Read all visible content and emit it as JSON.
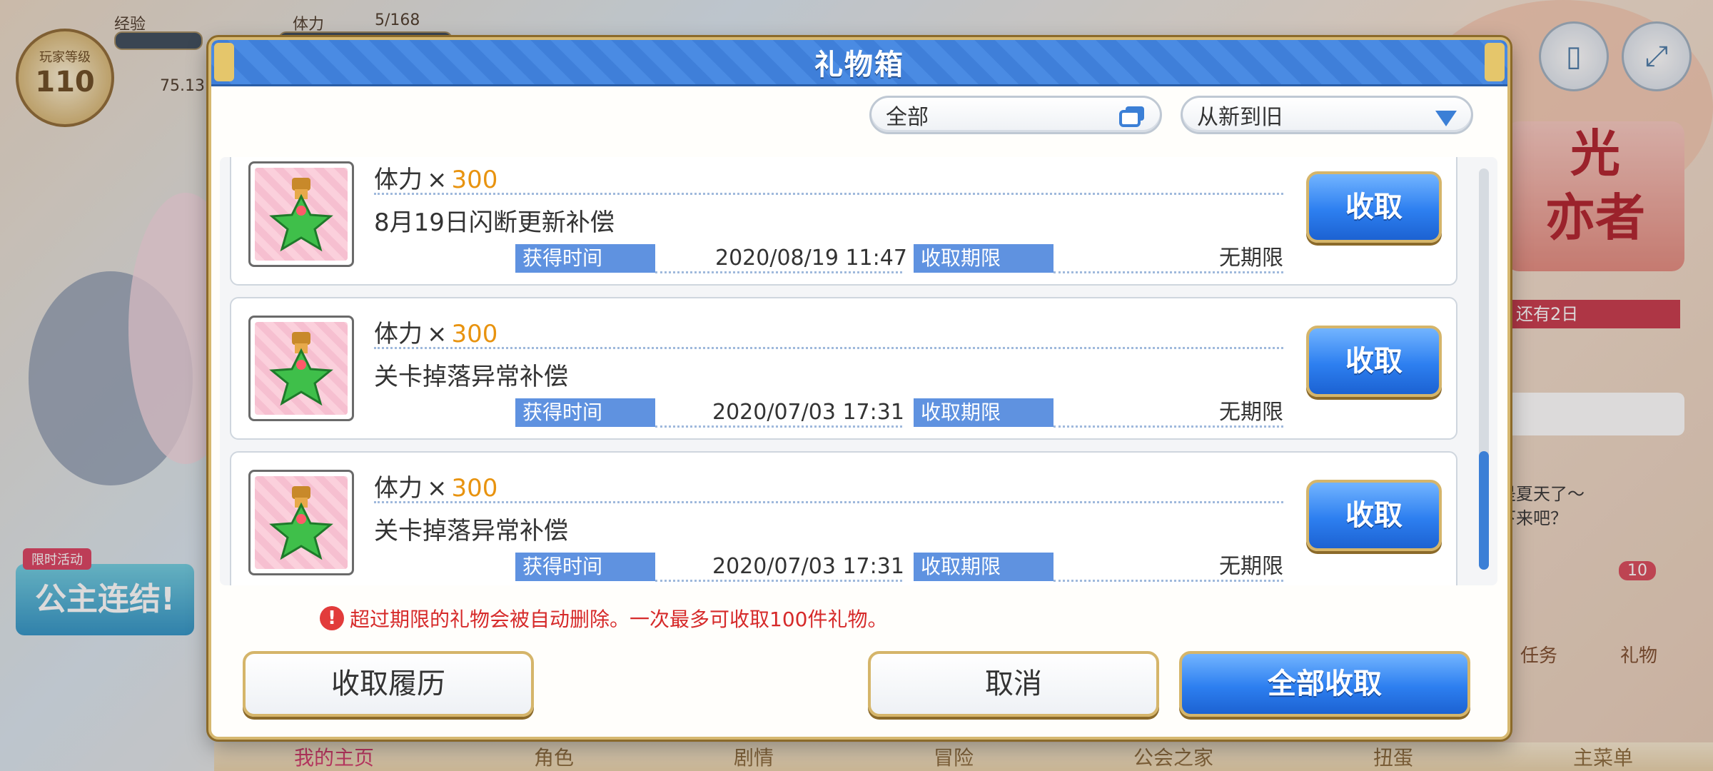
{
  "background": {
    "level_label": "玩家等级",
    "level_value": "110",
    "stamina_label": "体力",
    "stamina_value": "5/168",
    "exp_label": "经验",
    "extra_value": "75.13",
    "event_title": "光\n亦者",
    "event_days": "还有2日",
    "chat_line1": "是夏天了～",
    "chat_line2": "下来吧？",
    "left_tag": "限时活动",
    "left_banner": "公主连结!",
    "quest_label": "任务",
    "gift_label": "礼物",
    "gift_count": "10",
    "nav": [
      "我的主页",
      "角色",
      "剧情",
      "冒险",
      "公会之家",
      "扭蛋",
      "主菜单"
    ]
  },
  "modal": {
    "title": "礼物箱",
    "filter_label": "全部",
    "sort_label": "从新到旧",
    "items": [
      {
        "name": "体力",
        "times": "×",
        "qty": "300",
        "desc": "8月19日闪断更新补偿",
        "obtained_label": "获得时间",
        "obtained_value": "2020/08/19  11:47",
        "expire_label": "收取期限",
        "expire_value": "无期限",
        "claim_label": "收取"
      },
      {
        "name": "体力",
        "times": "×",
        "qty": "300",
        "desc": "关卡掉落异常补偿",
        "obtained_label": "获得时间",
        "obtained_value": "2020/07/03  17:31",
        "expire_label": "收取期限",
        "expire_value": "无期限",
        "claim_label": "收取"
      },
      {
        "name": "体力",
        "times": "×",
        "qty": "300",
        "desc": "关卡掉落异常补偿",
        "obtained_label": "获得时间",
        "obtained_value": "2020/07/03  17:31",
        "expire_label": "收取期限",
        "expire_value": "无期限",
        "claim_label": "收取"
      }
    ],
    "notice": "超过期限的礼物会被自动删除。一次最多可收取100件礼物。",
    "history_label": "收取履历",
    "cancel_label": "取消",
    "claim_all_label": "全部收取"
  },
  "colors": {
    "accent_blue": "#2d7ff0",
    "gold_border": "#d5b56a",
    "qty_orange": "#e8930f",
    "warning_red": "#d62a2a"
  },
  "icons": {
    "item_icon": "stamina-potion-icon",
    "filter_icon": "window-stack-icon",
    "sort_icon": "triangle-down-icon",
    "notice_icon": "exclamation-icon"
  }
}
